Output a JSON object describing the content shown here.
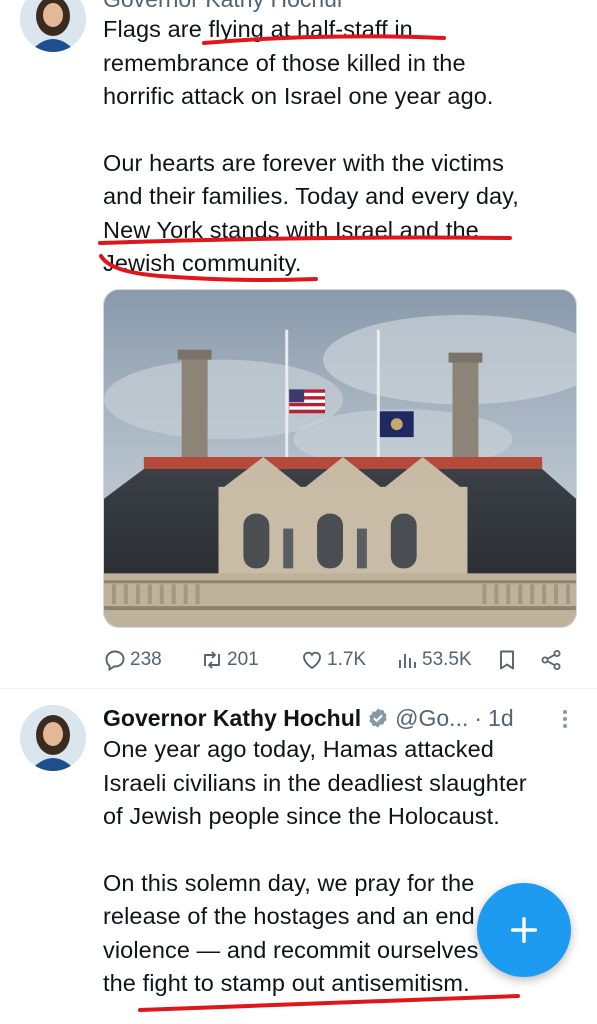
{
  "post1": {
    "header_cut": "Governor Kathy Hochul",
    "lines": [
      "Flags are flying at half-staff in",
      "remembrance of those killed in the",
      "horrific attack on Israel one year ago.",
      "",
      "Our hearts are forever with the victims",
      "and their families. Today and every day,",
      "New York stands with Israel and the",
      "Jewish community."
    ],
    "actions": {
      "replies": "238",
      "reposts": "201",
      "likes": "1.7K",
      "views": "53.5K"
    }
  },
  "post2": {
    "name": "Governor Kathy Hochul",
    "handle": "@Go...",
    "separator": "·",
    "time": "1d",
    "lines": [
      "One year ago today, Hamas attacked",
      "Israeli civilians in the deadliest slaughter",
      "of Jewish people since the Holocaust.",
      "",
      "On this solemn day, we pray for the",
      "release of the hostages and an end to the",
      "violence — and recommit ourselves to",
      "the fight to stamp out antisemitism."
    ]
  },
  "icons": {
    "reply": "reply-icon",
    "repost": "repost-icon",
    "like": "heart-icon",
    "views": "views-icon",
    "bookmark": "bookmark-icon",
    "share": "share-icon",
    "verified": "verified-badge-icon",
    "more": "more-icon",
    "compose": "plus-icon"
  },
  "colors": {
    "accent": "#1d9bf0",
    "text": "#0f1419",
    "muted": "#536471",
    "annotation": "#e0161b"
  }
}
